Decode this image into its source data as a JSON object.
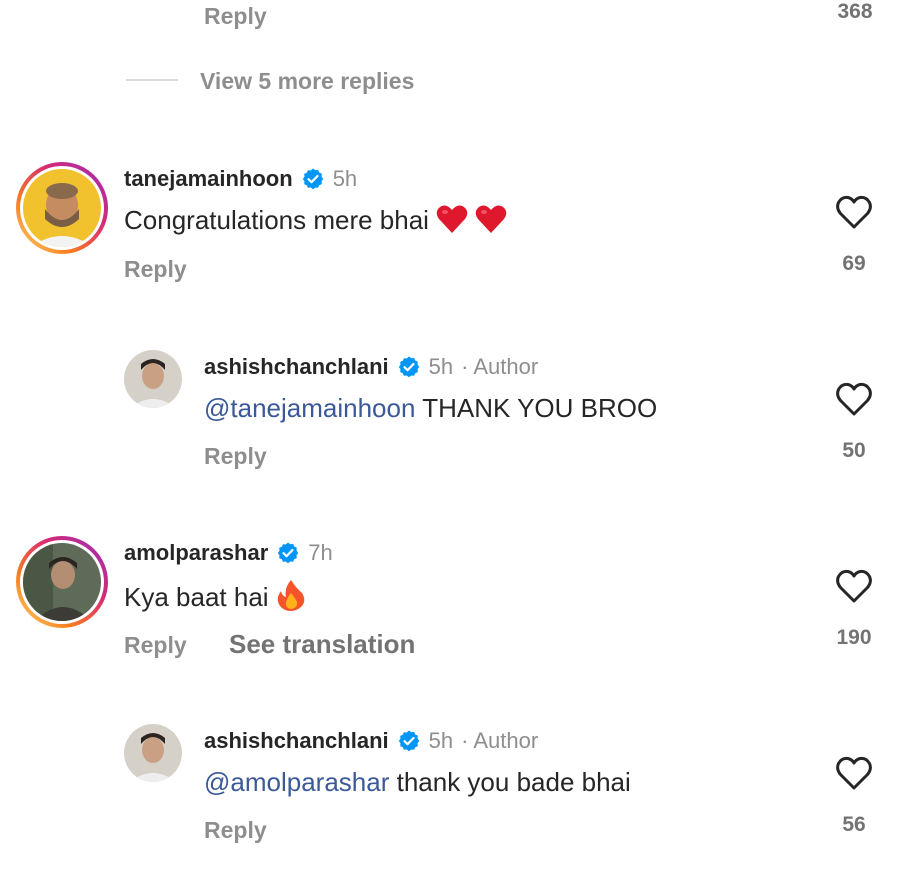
{
  "top": {
    "reply": "Reply",
    "likes": "368",
    "view_more": "View 5 more replies"
  },
  "comments": [
    {
      "username": "tanejamainhoon",
      "time": "5h",
      "text": "Congratulations mere bhai ",
      "reply": "Reply",
      "likes": "69"
    },
    {
      "username": "ashishchanchlani",
      "time": "5h",
      "author": "· Author",
      "mention": "@tanejamainhoon",
      "text": " THANK YOU BROO",
      "reply": "Reply",
      "likes": "50"
    },
    {
      "username": "amolparashar",
      "time": "7h",
      "text": "Kya baat hai ",
      "reply": "Reply",
      "see_translation": "See translation",
      "likes": "190"
    },
    {
      "username": "ashishchanchlani",
      "time": "5h",
      "author": "· Author",
      "mention": "@amolparashar",
      "text": " thank you bade bhai",
      "reply": "Reply",
      "likes": "56"
    }
  ],
  "icons": {
    "verified": "verified-badge-icon",
    "like": "heart-outline-icon",
    "emoji_heart": "red-heart-emoji",
    "emoji_fire": "fire-emoji"
  },
  "colors": {
    "verified_blue": "#0095f6",
    "mention": "#3b5998",
    "muted": "#8e8e8e",
    "heart_red": "#e0182d"
  }
}
